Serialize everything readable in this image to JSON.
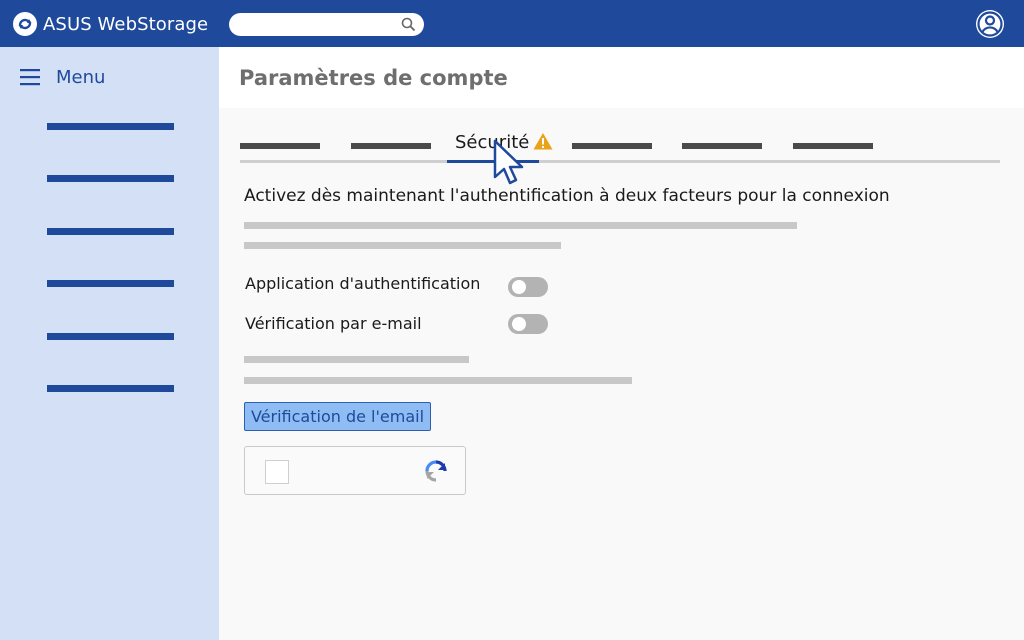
{
  "header": {
    "brand_name": "ASUS WebStorage",
    "logo_icon": "cloud-sync-icon",
    "search": {
      "value": "",
      "placeholder": "",
      "icon": "search-icon"
    },
    "user_icon": "user-avatar-icon",
    "colors": {
      "background": "#1f4a9c"
    }
  },
  "sidebar": {
    "menu_label": "Menu",
    "menu_icon": "hamburger-icon",
    "items": [
      "",
      "",
      "",
      "",
      "",
      ""
    ],
    "colors": {
      "background": "#d3e0f5",
      "accent": "#1f4a9c"
    }
  },
  "main": {
    "page_title": "Paramètres de compte",
    "tabs": [
      {
        "label": "",
        "active": false
      },
      {
        "label": "",
        "active": false
      },
      {
        "label": "Sécurité",
        "active": true,
        "icon": "warning-icon"
      },
      {
        "label": "",
        "active": false
      },
      {
        "label": "",
        "active": false
      },
      {
        "label": "",
        "active": false
      }
    ],
    "security": {
      "heading": "Activez dès maintenant l'authentification à deux facteurs pour la connexion",
      "options": [
        {
          "label": "Application d'authentification",
          "enabled": false
        },
        {
          "label": "Vérification par e-mail",
          "enabled": false
        }
      ],
      "email_button": "Vérification de l'email",
      "captcha": {
        "checked": false,
        "icon": "recaptcha-icon"
      }
    },
    "colors": {
      "warning": "#e8a317",
      "button_bg": "#8fbcf2"
    }
  }
}
